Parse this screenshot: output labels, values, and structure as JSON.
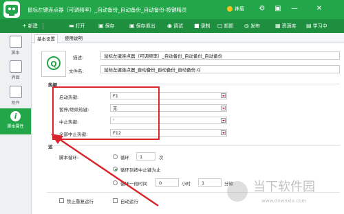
{
  "window": {
    "title": "鼠标左键连点器（可调频率）_自动备份_自动备份_自动备份-按键精灵",
    "vip_label": "神盾",
    "controls": {
      "settings": "⚙",
      "skin": "▣",
      "minimize": "—",
      "close": "✕"
    }
  },
  "toolbar": {
    "items": [
      {
        "label": "新建",
        "icon": "plus-icon"
      },
      {
        "label": "打开",
        "icon": "folder-icon"
      },
      {
        "label": "保存",
        "icon": "save-icon"
      },
      {
        "label": "保存退出",
        "icon": "save-exit-icon"
      },
      {
        "label": "调试",
        "icon": "debug-icon"
      },
      {
        "label": "录制",
        "icon": "record-icon"
      },
      {
        "label": "抓抓",
        "icon": "grab-icon"
      },
      {
        "label": "发布",
        "icon": "publish-icon"
      },
      {
        "label": "资源库",
        "icon": "library-icon"
      },
      {
        "label": "学习中",
        "icon": "learn-icon"
      }
    ]
  },
  "sidebar": {
    "items": [
      {
        "label": "脚本",
        "icon": "script-icon"
      },
      {
        "label": "界面",
        "icon": "ui-icon"
      },
      {
        "label": "附件",
        "icon": "attachment-icon"
      },
      {
        "label": "脚本属性",
        "icon": "info-icon",
        "active": true
      }
    ]
  },
  "tabs": [
    {
      "label": "基本设置",
      "active": true
    },
    {
      "label": "使用说明",
      "active": false
    }
  ],
  "basic": {
    "logo_text": "Q",
    "description_label": "描述:",
    "description_value": "鼠标左键连点器（可调频率）_自动备份_自动备份_自动备份",
    "filename_label": "文件名:",
    "filename_value": "鼠标左键连点器_自动备份_自动备份_自动备份.Q"
  },
  "hotkeys": {
    "section_title": "热键",
    "rows": [
      {
        "label": "启动热键:",
        "value": "F1"
      },
      {
        "label": "暂停/继续热键:",
        "value": "无"
      },
      {
        "label": "中止热键:",
        "value": "'"
      },
      {
        "label": "全部中止热键:",
        "value": "F12"
      }
    ]
  },
  "run": {
    "section_title": "运",
    "mode_label": "脚本循环:",
    "loop_label": "循环",
    "loop_count": "1",
    "loop_unit": "次",
    "until_label": "循环到按中止键为止",
    "period_label": "循环一段时间",
    "hours_value": "0",
    "hours_unit": "小时",
    "minutes_value": "1",
    "minutes_unit": "分钟",
    "forbid_repeat_label": "禁止重复运行",
    "auto_run_label": "自动运行"
  },
  "watermark": {
    "name": "当下软件园",
    "url": "www.downxia.com"
  },
  "colors": {
    "titlebar": "#23a64a",
    "toolbar": "#1d8f3f",
    "annotation_red": "#d8262c"
  }
}
